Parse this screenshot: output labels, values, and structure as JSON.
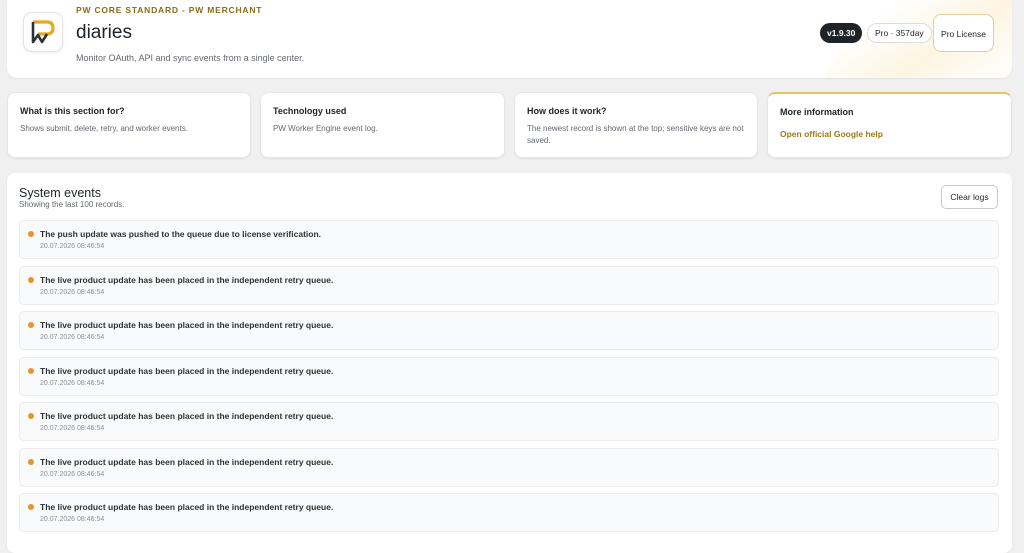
{
  "header": {
    "eyebrow": "PW CORE STANDARD - PW MERCHANT",
    "title": "diaries",
    "subtitle": "Monitor OAuth, API and sync events from a single center.",
    "version": "v1.9.30",
    "plan": "Pro · 357day",
    "license_button": "Pro License"
  },
  "info_cards": [
    {
      "title": "What is this section for?",
      "body": "Shows submit, delete, retry, and worker events."
    },
    {
      "title": "Technology used",
      "body": "PW Worker Engine event log."
    },
    {
      "title": "How does it work?",
      "body": "The newest record is shown at the top; sensitive keys are not saved."
    },
    {
      "title": "More information",
      "link": "Open official Google help"
    }
  ],
  "events": {
    "title": "System events",
    "subtitle": "Showing the last 100 records.",
    "clear_button": "Clear logs",
    "items": [
      {
        "message": "The push update was pushed to the queue due to license verification.",
        "time": "20.07.2026 08:46:54"
      },
      {
        "message": "The live product update has been placed in the independent retry queue.",
        "time": "20.07.2026 08:46:54"
      },
      {
        "message": "The live product update has been placed in the independent retry queue.",
        "time": "20.07.2026 08:46:54"
      },
      {
        "message": "The live product update has been placed in the independent retry queue.",
        "time": "20.07.2026 08:46:54"
      },
      {
        "message": "The live product update has been placed in the independent retry queue.",
        "time": "20.07.2026 08:46:54"
      },
      {
        "message": "The live product update has been placed in the independent retry queue.",
        "time": "20.07.2026 08:46:54"
      },
      {
        "message": "The live product update has been placed in the independent retry queue.",
        "time": "20.07.2026 08:46:54"
      }
    ]
  },
  "colors": {
    "accent": "#9c7a14",
    "status_dot": "#e8962a",
    "dark_badge": "#1d2327"
  }
}
